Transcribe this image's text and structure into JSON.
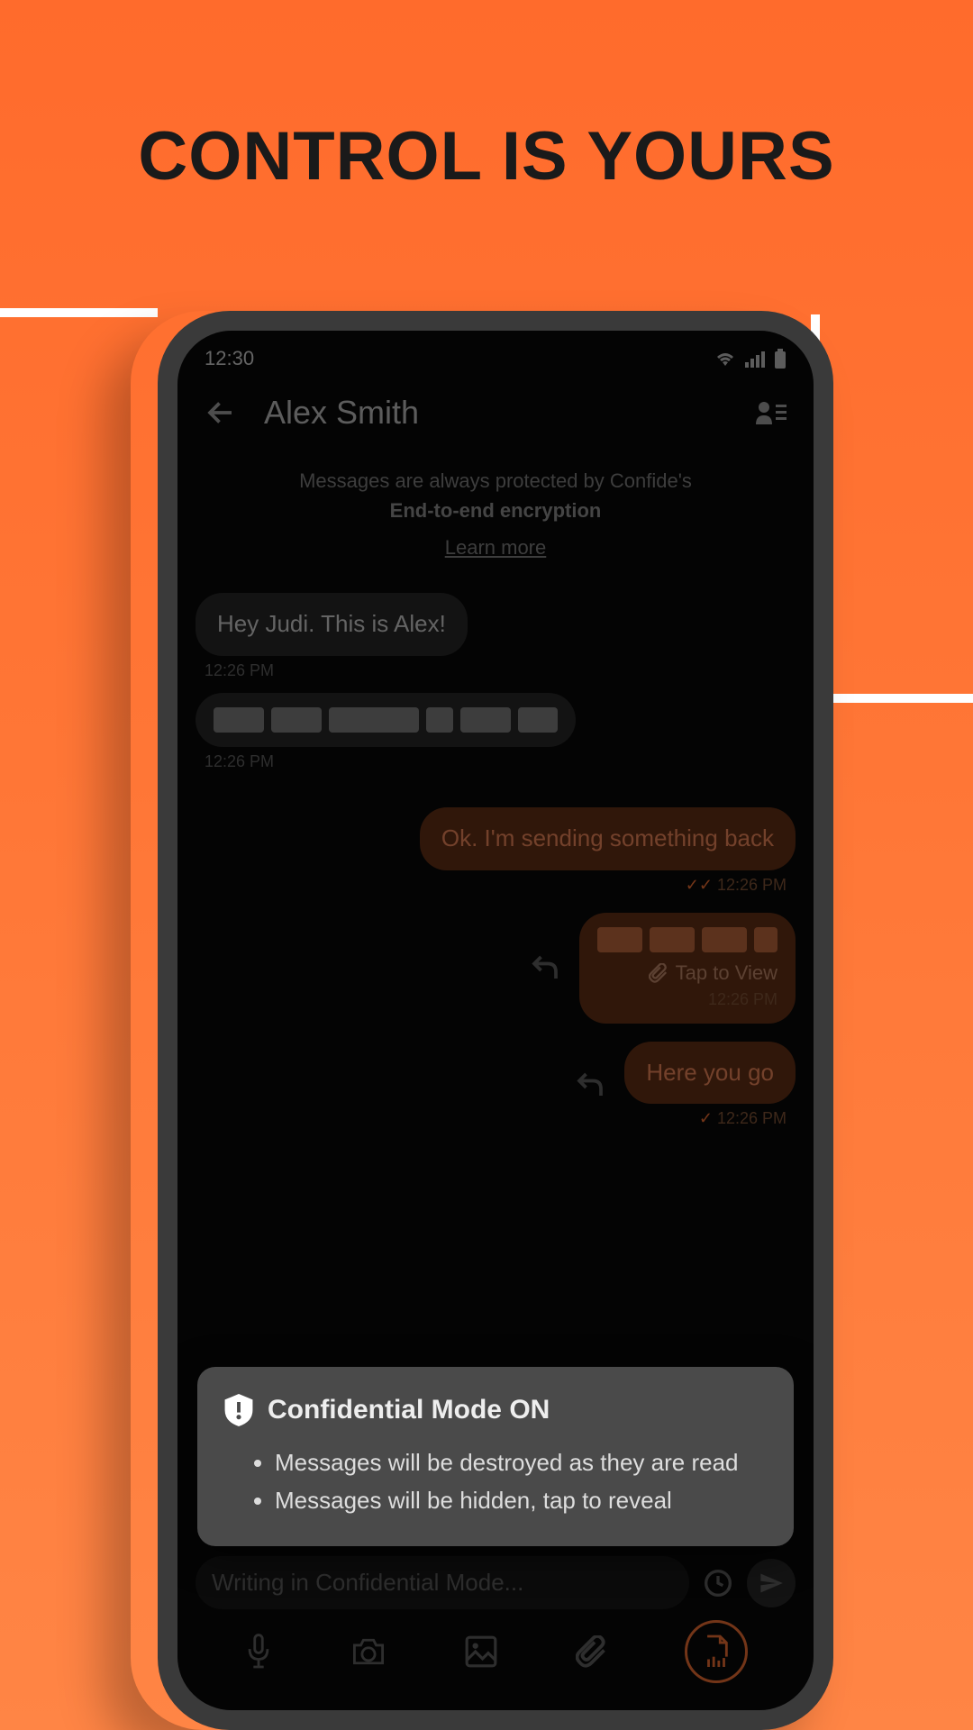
{
  "headline": "CONTROL IS YOURS",
  "status": {
    "time": "12:30"
  },
  "header": {
    "contact": "Alex Smith"
  },
  "encryption": {
    "line1": "Messages are always protected by Confide's",
    "line2": "End-to-end encryption",
    "learn_more": "Learn more"
  },
  "messages": {
    "m1": {
      "text": "Hey Judi. This is Alex!",
      "time": "12:26 PM"
    },
    "m2": {
      "time": "12:26 PM"
    },
    "m3": {
      "text": "Ok. I'm sending something back",
      "time": "12:26 PM"
    },
    "m4": {
      "tap_label": "Tap to View",
      "time": "12:26 PM"
    },
    "m5": {
      "text": "Here you go",
      "time": "12:26 PM"
    }
  },
  "confidential": {
    "title": "Confidential Mode ON",
    "bullet1": "Messages will be destroyed as they are read",
    "bullet2": "Messages will be hidden, tap to reveal"
  },
  "compose": {
    "placeholder": "Writing in Confidential Mode..."
  }
}
